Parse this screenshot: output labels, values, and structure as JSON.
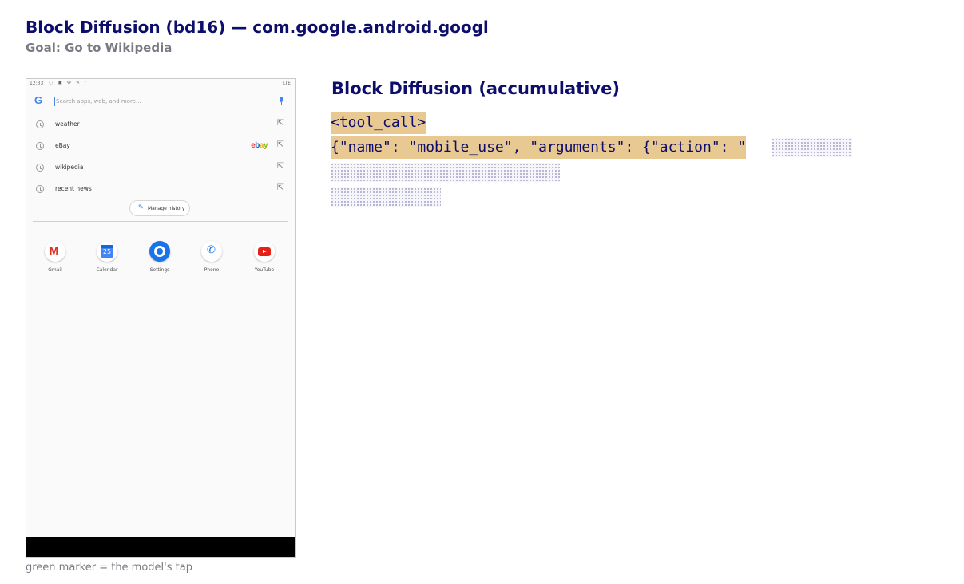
{
  "header": {
    "title": "Block Diffusion (bd16) — com.google.android.googl",
    "goal": "Goal: Go to Wikipedia"
  },
  "phone": {
    "status_time": "12:33",
    "status_right": "LTE",
    "search_placeholder": "Search apps, web, and more...",
    "history": [
      {
        "label": "weather"
      },
      {
        "label": "eBay"
      },
      {
        "label": "wikipedia"
      },
      {
        "label": "recent news"
      }
    ],
    "ebay_logo": [
      "e",
      "b",
      "a",
      "y"
    ],
    "manage_history": "Manage history",
    "apps": [
      {
        "label": "Gmail",
        "icon": "gmail-icon"
      },
      {
        "label": "Calendar",
        "icon": "calendar-icon",
        "day": "25"
      },
      {
        "label": "Settings",
        "icon": "settings-icon"
      },
      {
        "label": "Phone",
        "icon": "phone-icon"
      },
      {
        "label": "YouTube",
        "icon": "youtube-icon"
      }
    ]
  },
  "caption": "green marker = the model's tap",
  "panel": {
    "title": "Block Diffusion (accumulative)",
    "line1": "<tool_call>",
    "line2": "{\"name\": \"mobile_use\", \"arguments\": {\"action\": \""
  },
  "colors": {
    "title": "#0d0d6b",
    "revealed_token_bg": "#e8c992",
    "masked_token": "#a3a3c8"
  }
}
